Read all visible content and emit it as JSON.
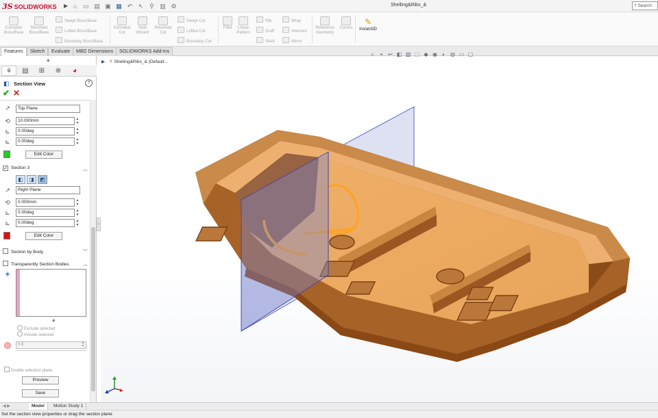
{
  "app": {
    "brand_ds": "3S",
    "brand_name": "SOLIDWORKS",
    "document_title": "Shelling&Ribs_&",
    "search_placeholder": "Search"
  },
  "quick_access_icons": [
    "home-icon",
    "new-file-icon",
    "open-file-icon",
    "save-icon",
    "print-icon",
    "undo-icon",
    "select-icon",
    "rebuild-icon",
    "file-properties-icon",
    "options-icon"
  ],
  "ribbon": {
    "extruded_boss": "Extruded Boss/Base",
    "revolved_boss": "Revolved Boss/Base",
    "swept_boss": "Swept Boss/Base",
    "lofted_boss": "Lofted Boss/Base",
    "boundary_boss": "Boundary Boss/Base",
    "extruded_cut": "Extruded Cut",
    "hole_wizard": "Hole Wizard",
    "revolved_cut": "Revolved Cut",
    "swept_cut": "Swept Cut",
    "lofted_cut": "Lofted Cut",
    "boundary_cut": "Boundary Cut",
    "fillet": "Fillet",
    "linear_pattern": "Linear Pattern",
    "rib": "Rib",
    "draft": "Draft",
    "shell": "Shell",
    "wrap": "Wrap",
    "intersect": "Intersect",
    "mirror": "Mirror",
    "reference_geometry": "Reference Geometry",
    "curves": "Curves",
    "instant3d": "Instant3D"
  },
  "tabs": [
    "Features",
    "Sketch",
    "Evaluate",
    "MBD Dimensions",
    "SOLIDWORKS Add-Ins"
  ],
  "panel": {
    "title": "Section View",
    "section2": {
      "plane": "Top Plane",
      "offset": "10.000mm",
      "angle_x": "0.00deg",
      "angle_y": "0.00deg",
      "edit_color": "Edit Color",
      "color": "#22cc22"
    },
    "section3": {
      "label": "Section 3",
      "plane": "Right Plane",
      "offset": "0.000mm",
      "angle_x": "0.00deg",
      "angle_y": "0.00deg",
      "edit_color": "Edit Color",
      "color": "#dd1111"
    },
    "section_by_body": "Section by Body",
    "transparent_bodies": "Transparently Section Bodies",
    "exclude_selected": "Exclude selected",
    "include_selected": "Include selected",
    "transparency_value": "0.8",
    "enable_selection_plane": "Enable selection plane",
    "preview": "Preview",
    "save": "Save"
  },
  "view_toolbar_icons": [
    "zoom-to-fit-icon",
    "zoom-area-icon",
    "previous-view-icon",
    "section-view-icon",
    "dynamic-annotation-icon",
    "view-orientation-icon",
    "display-style-icon",
    "hide-show-icon",
    "edit-appearance-icon",
    "apply-scene-icon",
    "view-settings-icon",
    "display-monitor-icon"
  ],
  "breadcrumb": "Shelling&Ribs_& (Default...",
  "bottom_tabs": [
    "Model",
    "Motion Study 1"
  ],
  "status_text": "Set the section view properties or drag the section plane"
}
